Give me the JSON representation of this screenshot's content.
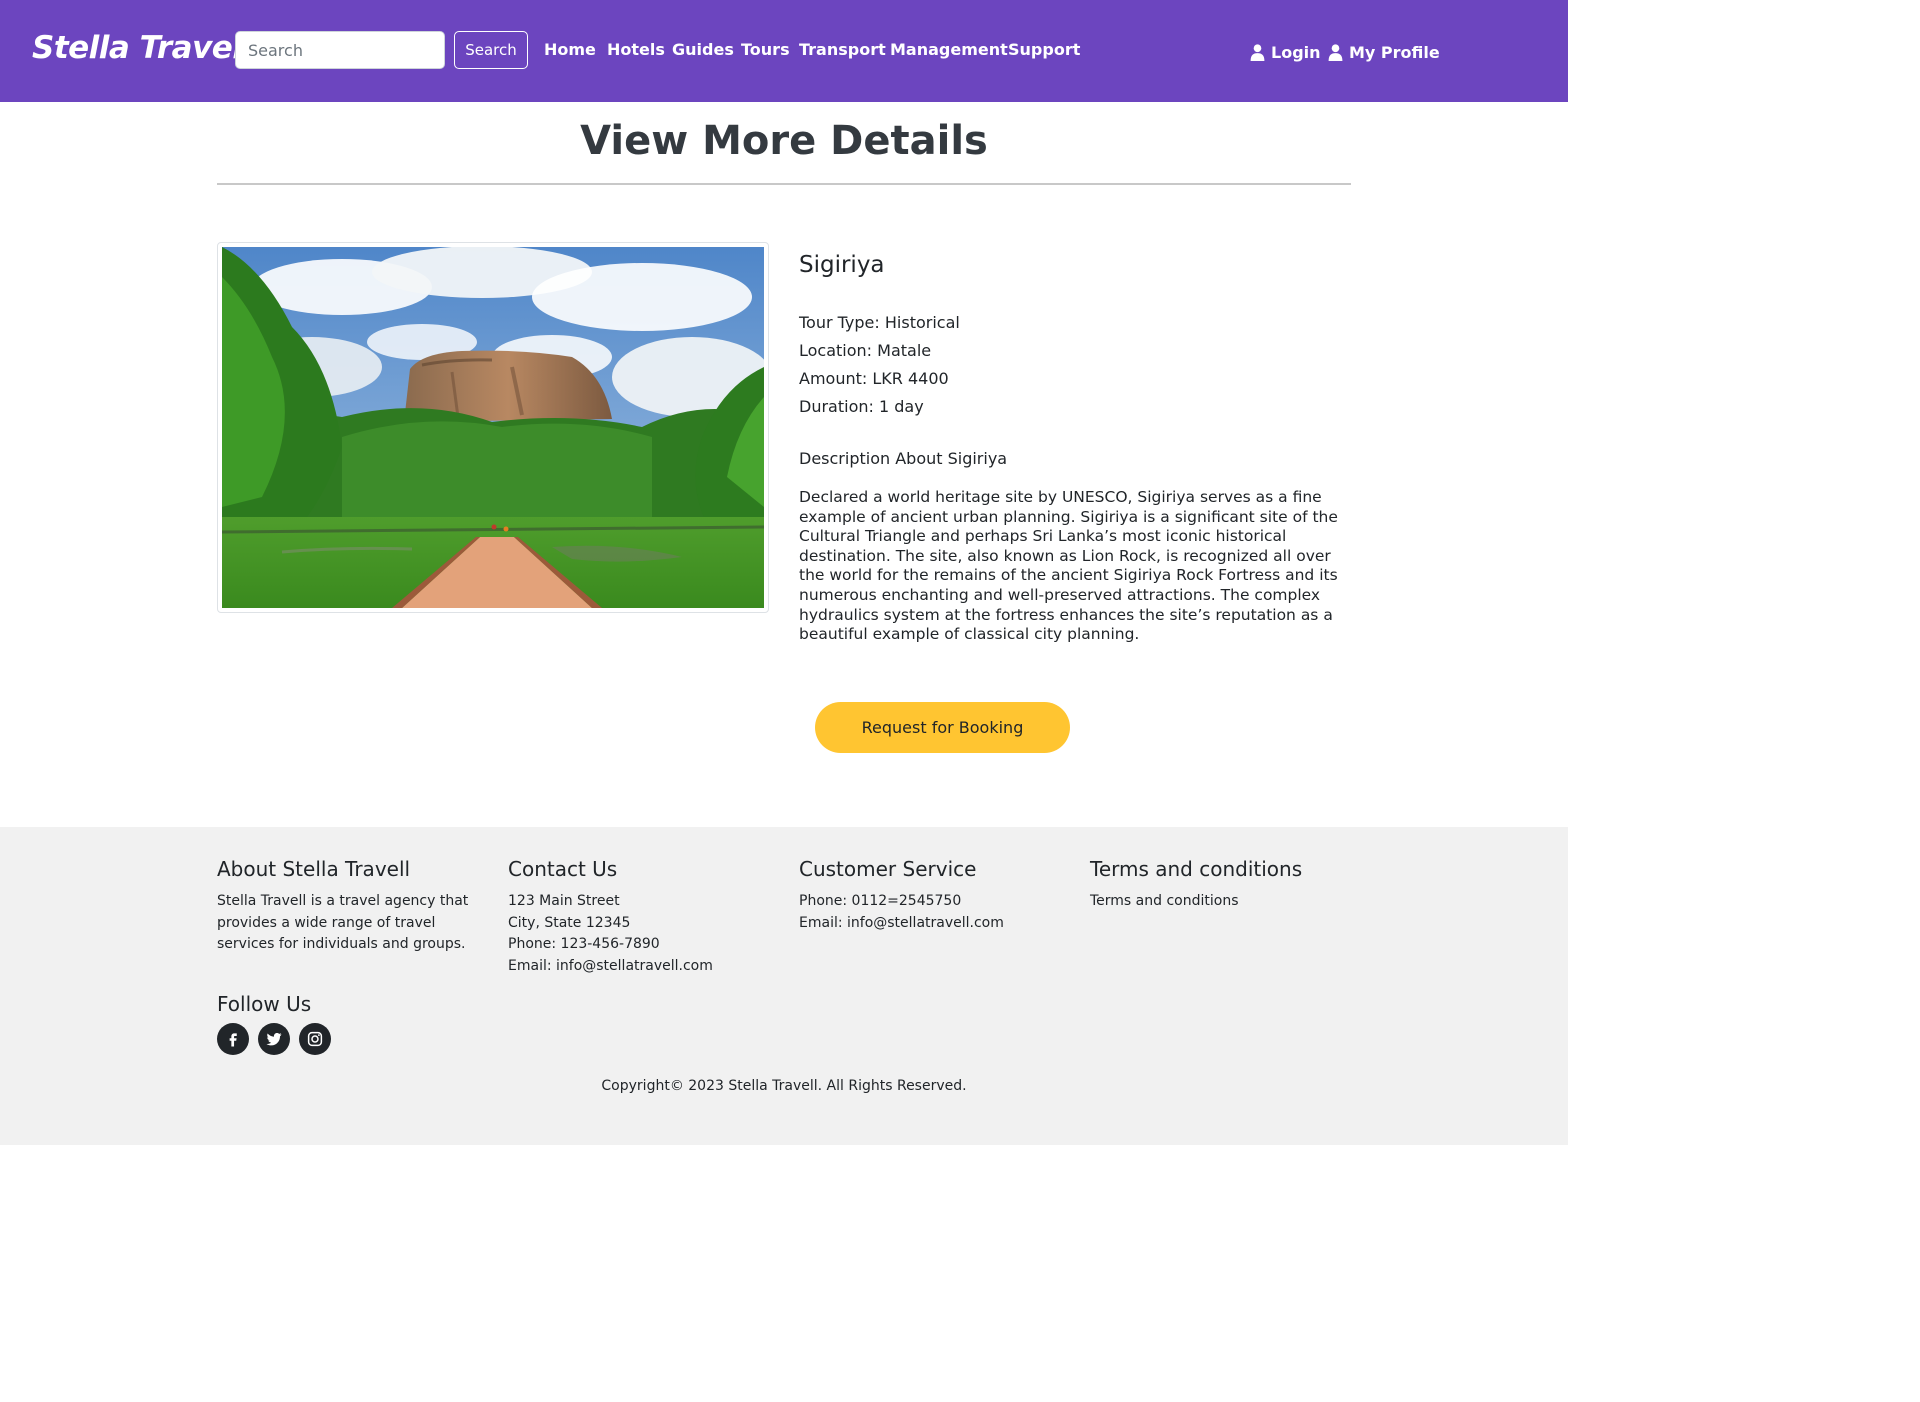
{
  "navbar": {
    "brand": "Stella Travel",
    "search_placeholder": "Search",
    "search_button": "Search",
    "links": [
      "Home",
      "Hotels",
      "Guides",
      "Tours",
      "Transport",
      "Management",
      "Support"
    ],
    "login": "Login",
    "profile": "My Profile",
    "background_color": "#6c45bf"
  },
  "page": {
    "title": "View More Details"
  },
  "tour": {
    "name": "Sigiriya",
    "tour_type": "Tour Type: Historical",
    "location": "Location: Matale",
    "amount": "Amount: LKR 4400",
    "duration": "Duration: 1 day",
    "description_heading": "Description About Sigiriya",
    "description": "Declared a world heritage site by UNESCO, Sigiriya serves as a fine example of ancient urban planning. Sigiriya is a significant site of the Cultural Triangle and perhaps Sri Lanka’s most iconic historical destination. The site, also known as Lion Rock, is recognized all over the world for the remains of the ancient Sigiriya Rock Fortress and its numerous enchanting and well-preserved attractions. The complex hydraulics system at the fortress enhances the site’s reputation as a beautiful example of classical city planning.",
    "booking_button": "Request for Booking",
    "booking_color": "#ffc531"
  },
  "footer": {
    "about": {
      "heading": "About Stella Travell",
      "text": "Stella Travell is a travel agency that provides a wide range of travel services for individuals and groups."
    },
    "contact": {
      "heading": "Contact Us",
      "lines": [
        "123 Main Street",
        "City, State 12345",
        "Phone: 123-456-7890",
        "Email: info@stellatravell.com"
      ]
    },
    "customer_service": {
      "heading": "Customer Service",
      "lines": [
        "Phone: 0112=2545750",
        "Email: info@stellatravell.com"
      ]
    },
    "terms": {
      "heading": "Terms and conditions",
      "link": "Terms and conditions"
    },
    "follow_heading": "Follow Us",
    "socials": [
      "facebook-icon",
      "twitter-icon",
      "instagram-icon"
    ],
    "copyright": "Copyright© 2023 Stella Travell. All Rights Reserved."
  }
}
